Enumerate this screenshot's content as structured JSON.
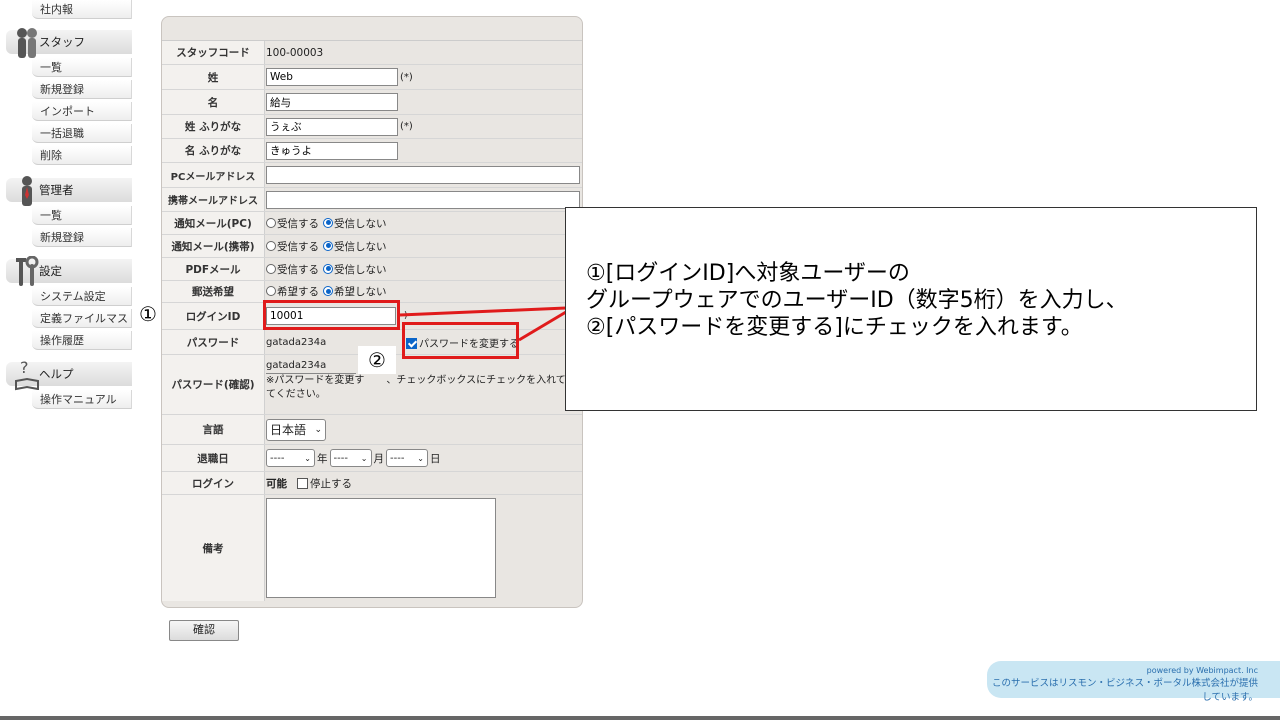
{
  "sidebar": {
    "top_item": "社内報",
    "sections": [
      {
        "title": "スタッフ",
        "items": [
          "一覧",
          "新規登録",
          "インポート",
          "一括退職",
          "削除"
        ]
      },
      {
        "title": "管理者",
        "items": [
          "一覧",
          "新規登録"
        ]
      },
      {
        "title": "設定",
        "items": [
          "システム設定",
          "定義ファイルマスタ",
          "操作履歴"
        ]
      },
      {
        "title": "ヘルプ",
        "items": [
          "操作マニュアル"
        ]
      }
    ]
  },
  "form": {
    "staff_code": {
      "label": "スタッフコード",
      "value": "100-00003"
    },
    "last_name": {
      "label": "姓",
      "value": "Web",
      "req": "(*)"
    },
    "first_name": {
      "label": "名",
      "value": "給与"
    },
    "last_kana": {
      "label": "姓 ふりがな",
      "value": "うぇぶ",
      "req": "(*)"
    },
    "first_kana": {
      "label": "名 ふりがな",
      "value": "きゅうよ"
    },
    "pc_mail": {
      "label": "PCメールアドレス",
      "value": ""
    },
    "mobile_mail": {
      "label": "携帯メールアドレス",
      "value": ""
    },
    "notify_pc": {
      "label": "通知メール(PC)",
      "opt1": "受信する",
      "opt2": "受信しない"
    },
    "notify_mobile": {
      "label": "通知メール(携帯)",
      "opt1": "受信する",
      "opt2": "受信しない"
    },
    "pdf_mail": {
      "label": "PDFメール",
      "opt1": "受信する",
      "opt2": "受信しない"
    },
    "mail_wish": {
      "label": "郵送希望",
      "opt1": "希望する",
      "opt2": "希望しない"
    },
    "login_id": {
      "label": "ログインID",
      "value": "10001",
      "note": ")"
    },
    "password": {
      "label": "パスワード",
      "value": "gatada234a",
      "change_label": "パスワードを変更する"
    },
    "password_confirm": {
      "label": "パスワード(確認)",
      "value": "gatada234a",
      "note1": "※パスワードを変更す",
      "note2": "、チェックボックスにチェックを入れて変更",
      "note3": "てください。"
    },
    "language": {
      "label": "言語",
      "value": "日本語"
    },
    "retire_date": {
      "label": "退職日",
      "year": "----",
      "year_unit": "年",
      "month": "----",
      "month_unit": "月",
      "day": "----",
      "day_unit": "日"
    },
    "login": {
      "label": "ログイン",
      "status": "可能",
      "stop_label": "停止する"
    },
    "remarks": {
      "label": "備考",
      "value": ""
    }
  },
  "confirm_button": "確認",
  "annotations": {
    "marker1": "①",
    "marker2": "②",
    "callout_line1": "①[ログインID]へ対象ユーザーの",
    "callout_line2": "グループウェアでのユーザーID（数字5桁）を入力し、",
    "callout_line3": "②[パスワードを変更する]にチェックを入れます。",
    "accent_color": "#e01b1b"
  },
  "footer": {
    "powered": "powered by Webimpact. Inc",
    "notice": "このサービスはリスモン・ビジネス・ポータル株式会社が提供しています。"
  }
}
